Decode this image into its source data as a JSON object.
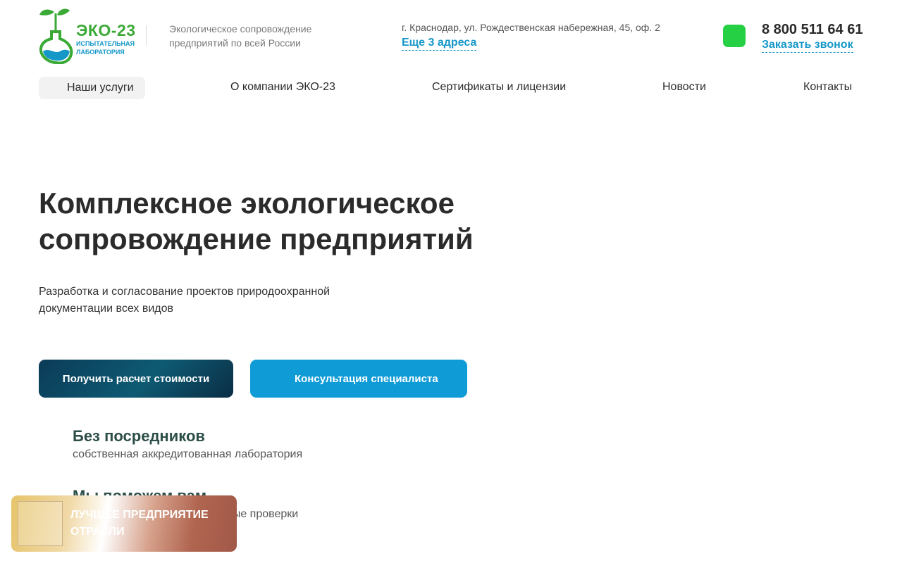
{
  "header": {
    "logo_text": "ЭКО-23",
    "logo_sub": "ИСПЫТАТЕЛЬНАЯ ЛАБОРАТОРИЯ",
    "tagline": "Экологическое сопровождение предприятий по всей России",
    "address": "г. Краснодар, ул. Рождественская набережная, 45, оф. 2",
    "more_addresses": "Еще 3 адреса",
    "phone": "8 800 511 64 61",
    "callback": "Заказать звонок"
  },
  "nav": {
    "items": [
      "Наши услуги",
      "О компании ЭКО-23",
      "Сертификаты и лицензии",
      "Новости",
      "Контакты"
    ]
  },
  "hero": {
    "title": "Комплексное экологическое сопровождение предприятий",
    "description": "Разработка и согласование проектов природоохранной документации всех видов",
    "btn_calc": "Получить расчет стоимости",
    "btn_consult": "Консультация специалиста"
  },
  "features": [
    {
      "title": "Без посредников",
      "desc": "собственная аккредитованная лаборатория"
    },
    {
      "title": "Мы поможем вам",
      "desc": "пройти плановые и внеплановые проверки"
    }
  ],
  "badge": {
    "text": "ЛУЧШЕЕ ПРЕДПРИЯТИЕ ОТРАСЛИ"
  },
  "colors": {
    "brand_green": "#3aa935",
    "brand_blue": "#1597c8",
    "dark_button": "#0b3b57",
    "whatsapp": "#25d044"
  }
}
